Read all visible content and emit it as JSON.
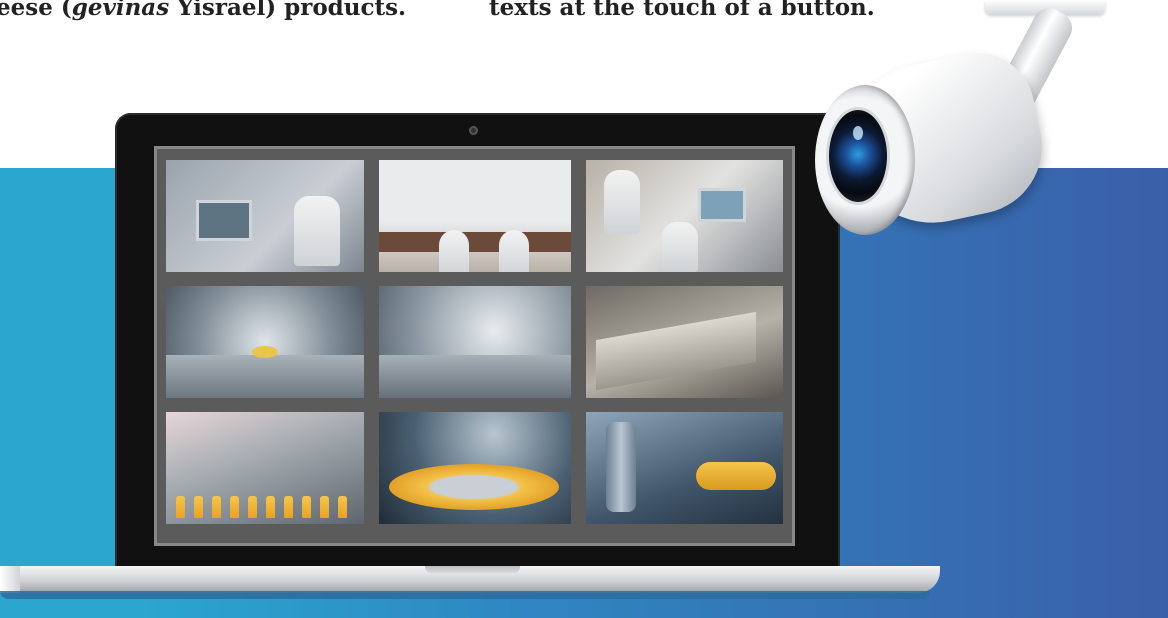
{
  "text_left": {
    "prefix": "eese (",
    "italic": "gevinas",
    "suffix": " Yisrael) products."
  },
  "text_right": "texts at the touch of a button.",
  "colors": {
    "banner_start": "#2aa6cf",
    "banner_end": "#3a5fa9",
    "laptop_bezel": "#111111"
  },
  "monitor_feeds": [
    "factory-worker-control-panel",
    "factory-floor-workers",
    "factory-worker-machine",
    "empty-factory-hall",
    "empty-factory-hall-wide",
    "production-machinery",
    "bottling-line-juice",
    "bottling-conveyor-curve",
    "bottling-line-tanks"
  ]
}
